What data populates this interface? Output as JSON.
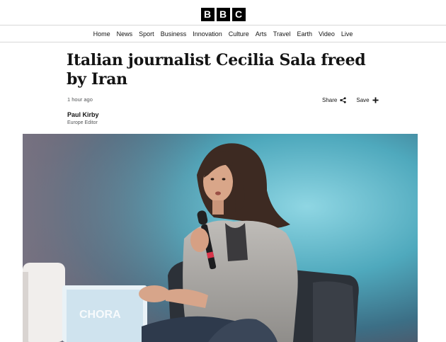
{
  "brand": {
    "logo_letters": [
      "B",
      "B",
      "C"
    ]
  },
  "nav": {
    "items": [
      "Home",
      "News",
      "Sport",
      "Business",
      "Innovation",
      "Culture",
      "Arts",
      "Travel",
      "Earth",
      "Video",
      "Live"
    ]
  },
  "article": {
    "headline": "Italian journalist Cecilia Sala freed by Iran",
    "timestamp": "1 hour ago",
    "author_name": "Paul Kirby",
    "author_role": "Europe Editor",
    "share_label": "Share",
    "save_label": "Save",
    "share_icon": "share-icon",
    "save_icon": "plus-icon"
  },
  "hero_image": {
    "screen_text": "CHORA"
  },
  "colors": {
    "text": "#141414",
    "muted": "#545658",
    "divider": "#d8d8d8",
    "logo_bg": "#000000"
  }
}
